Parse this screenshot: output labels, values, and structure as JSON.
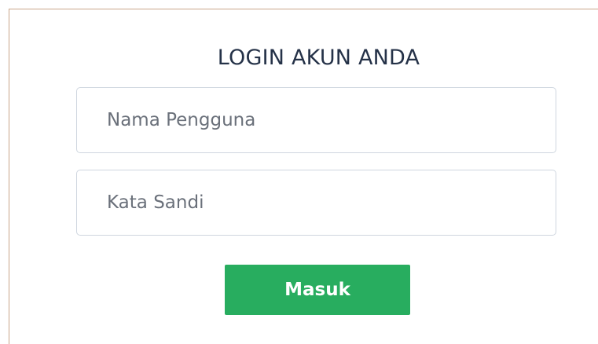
{
  "login_form": {
    "title": "LOGIN AKUN ANDA",
    "username": {
      "placeholder": "Nama Pengguna",
      "value": ""
    },
    "password": {
      "placeholder": "Kata Sandi",
      "value": ""
    },
    "submit_label": "Masuk"
  },
  "colors": {
    "primary_button": "#28ad5f",
    "title_text": "#253248",
    "input_border": "#cfd6df",
    "page_border": "#c9a68a"
  }
}
